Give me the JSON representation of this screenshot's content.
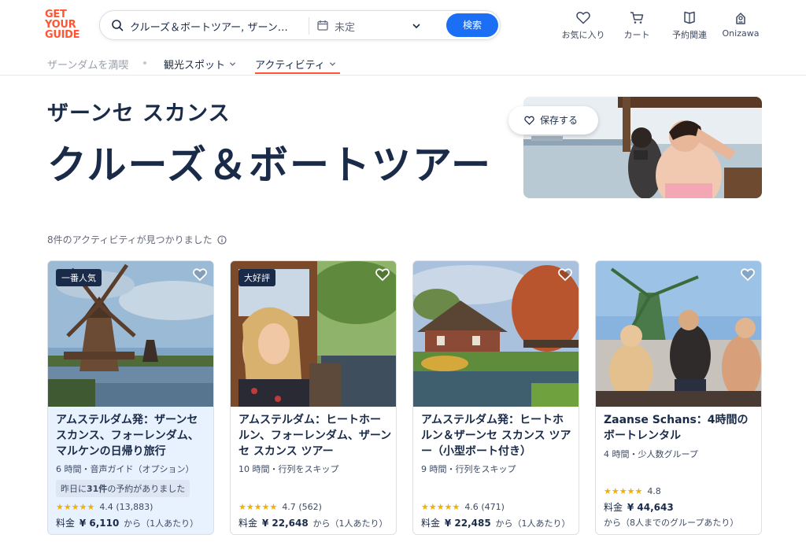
{
  "header": {
    "logo": [
      "GET",
      "YOUR",
      "GUIDE"
    ],
    "search_text": "クルーズ＆ボートツアー, ザーン…",
    "date_text": "未定",
    "search_button": "検索",
    "nav": [
      {
        "label": "お気に入り",
        "icon": "heart-icon"
      },
      {
        "label": "カート",
        "icon": "cart-icon"
      },
      {
        "label": "予約関連",
        "icon": "ticket-icon"
      },
      {
        "label": "Onizawa",
        "icon": "user-icon"
      }
    ]
  },
  "subnav": {
    "breadcrumb": "ザーンダムを満喫",
    "items": [
      "観光スポット",
      "アクティビティ"
    ]
  },
  "hero": {
    "location": "ザーンセ スカンス",
    "title": "クルーズ＆ボートツアー",
    "save_label": "保存する"
  },
  "results": {
    "count_text": "8件のアクティビティが見つかりました"
  },
  "colors": {
    "accent": "#1b6ff5",
    "brand": "#ff5533",
    "navy": "#1a2b49",
    "star": "#f2b000",
    "highlight": "#e8f1fe"
  },
  "cards": [
    {
      "badge": "一番人気",
      "title": "アムステルダム発：ザーンセ スカンス、フォーレンダム、マルケンの日帰り旅行",
      "meta": "6 時間・音声ガイド（オプション）",
      "note_prefix": "昨日に",
      "note_bold": "31件",
      "note_suffix": "の予約がありました",
      "stars": "★★★★★",
      "rating": "4.4",
      "reviews": "(13,883)",
      "price_label": "料金",
      "price": "¥ 6,110",
      "price_suffix": "から（1人あたり）"
    },
    {
      "badge": "大好評",
      "title": "アムステルダム：ヒートホールン、フォーレンダム、ザーンセ スカンス ツアー",
      "meta": "10 時間・行列をスキップ",
      "stars": "★★★★★",
      "rating": "4.7",
      "reviews": "(562)",
      "price_label": "料金",
      "price": "¥ 22,648",
      "price_suffix": "から（1人あたり）"
    },
    {
      "title": "アムステルダム発：ヒートホルン＆ザーンセ スカンス ツアー（小型ボート付き）",
      "meta": "9 時間・行列をスキップ",
      "stars": "★★★★★",
      "rating": "4.6",
      "reviews": "(471)",
      "price_label": "料金",
      "price": "¥ 22,485",
      "price_suffix": "から（1人あたり）"
    },
    {
      "title": "Zaanse Schans：4時間のボートレンタル",
      "meta": "4 時間・少人数グループ",
      "stars": "★★★★★",
      "rating": "4.8",
      "price_label": "料金",
      "price": "¥ 44,643",
      "price_suffix": "から（8人までのグループあたり）"
    }
  ]
}
